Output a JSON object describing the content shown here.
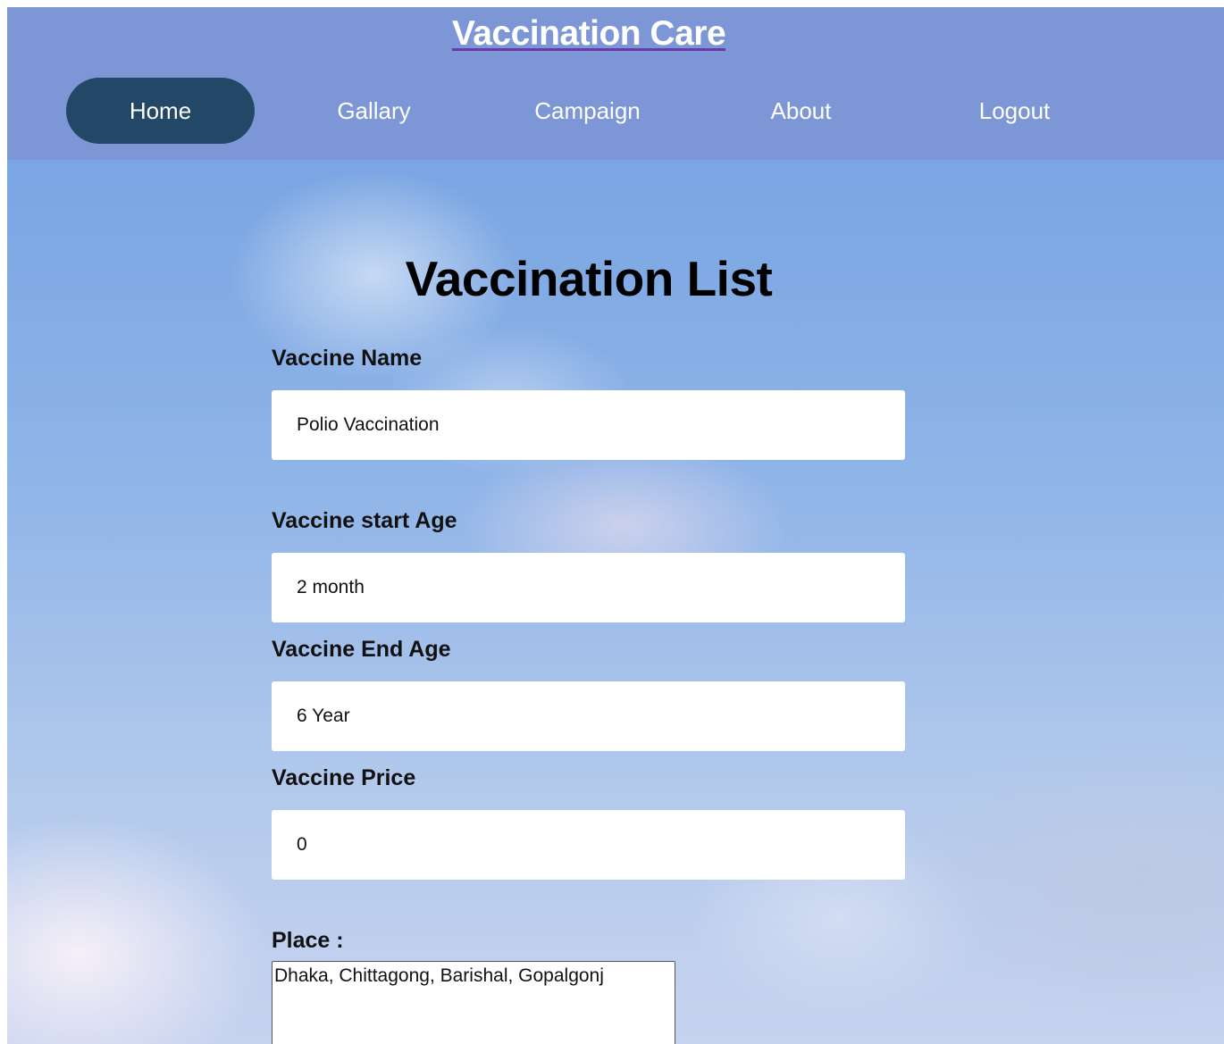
{
  "header": {
    "site_title": "Vaccination Care",
    "nav": [
      {
        "label": "Home",
        "active": true
      },
      {
        "label": "Gallary",
        "active": false
      },
      {
        "label": "Campaign",
        "active": false
      },
      {
        "label": "About",
        "active": false
      },
      {
        "label": "Logout",
        "active": false
      }
    ]
  },
  "form": {
    "title": "Vaccination List",
    "vaccine_name": {
      "label": "Vaccine Name",
      "value": "Polio Vaccination"
    },
    "start_age": {
      "label": "Vaccine start Age",
      "value": "2 month"
    },
    "end_age": {
      "label": "Vaccine End Age",
      "value": "6 Year"
    },
    "price": {
      "label": "Vaccine Price",
      "value": "0"
    },
    "place": {
      "label": "Place :",
      "value": "Dhaka, Chittagong, Barishal, Gopalgonj"
    }
  },
  "colors": {
    "header_bg": "#7d97d6",
    "active_nav_bg": "#234766",
    "title_underline": "#6a3aa8"
  }
}
